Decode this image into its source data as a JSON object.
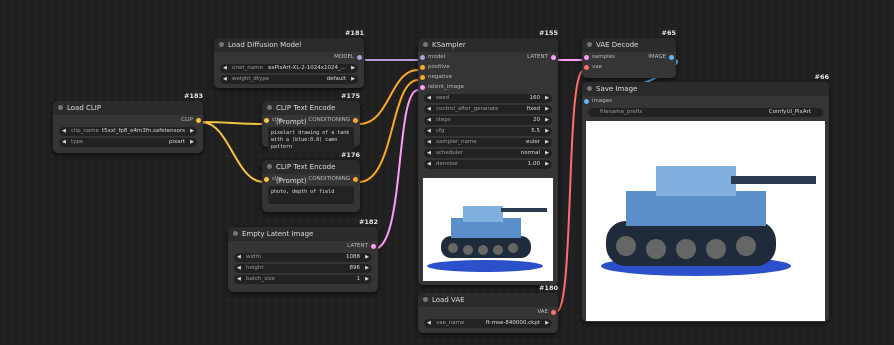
{
  "colors": {
    "model": "#b39ddb",
    "clip": "#f4c542",
    "conditioning": "#ffa726",
    "latent": "#ff9cf9",
    "vae": "#ff6e6e",
    "image": "#64b5f6"
  },
  "nodes": {
    "load_diffusion": {
      "id": "#181",
      "title": "Load Diffusion Model",
      "output": "MODEL",
      "widgets": [
        {
          "label": "unet_name",
          "value": "exPixArt-XL-2-1024x1024_..."
        },
        {
          "label": "weight_dtype",
          "value": "default"
        }
      ]
    },
    "load_clip": {
      "id": "#183",
      "title": "Load CLIP",
      "output": "CLIP",
      "widgets": [
        {
          "label": "clip_name",
          "value": "t5xxl_fp8_e4m3fn.safetensors"
        },
        {
          "label": "type",
          "value": "pixart"
        }
      ]
    },
    "clip_text_1": {
      "id": "#175",
      "title": "CLIP Text Encode (Prompt)",
      "input": "clip",
      "output": "CONDITIONING",
      "text": "pixelart drawing of a tank with a (blue:0.8) camo pattern"
    },
    "clip_text_2": {
      "id": "#176",
      "title": "CLIP Text Encode (Prompt)",
      "input": "clip",
      "output": "CONDITIONING",
      "text": "photo, depth of field"
    },
    "empty_latent": {
      "id": "#182",
      "title": "Empty Latent Image",
      "output": "LATENT",
      "widgets": [
        {
          "label": "width",
          "value": "1088"
        },
        {
          "label": "height",
          "value": "896"
        },
        {
          "label": "batch_size",
          "value": "1"
        }
      ]
    },
    "ksampler": {
      "id": "#155",
      "title": "KSampler",
      "output": "LATENT",
      "inputs": [
        "model",
        "positive",
        "negative",
        "latent_image"
      ],
      "widgets": [
        {
          "label": "seed",
          "value": "160"
        },
        {
          "label": "control_after_generate",
          "value": "fixed"
        },
        {
          "label": "steps",
          "value": "20"
        },
        {
          "label": "cfg",
          "value": "5.5"
        },
        {
          "label": "sampler_name",
          "value": "euler"
        },
        {
          "label": "scheduler",
          "value": "normal"
        },
        {
          "label": "denoise",
          "value": "1.00"
        }
      ]
    },
    "vae_decode": {
      "id": "#65",
      "title": "VAE Decode",
      "inputs": [
        "samples",
        "vae"
      ],
      "output": "IMAGE"
    },
    "save_image": {
      "id": "#66",
      "title": "Save Image",
      "input": "images",
      "widgets": [
        {
          "label": "filename_prefix",
          "value": "ComfyUI_PixArt"
        }
      ]
    },
    "load_vae": {
      "id": "#180",
      "title": "Load VAE",
      "output": "VAE",
      "widgets": [
        {
          "label": "vae_name",
          "value": "ft-mse-840000.ckpt"
        }
      ]
    }
  }
}
